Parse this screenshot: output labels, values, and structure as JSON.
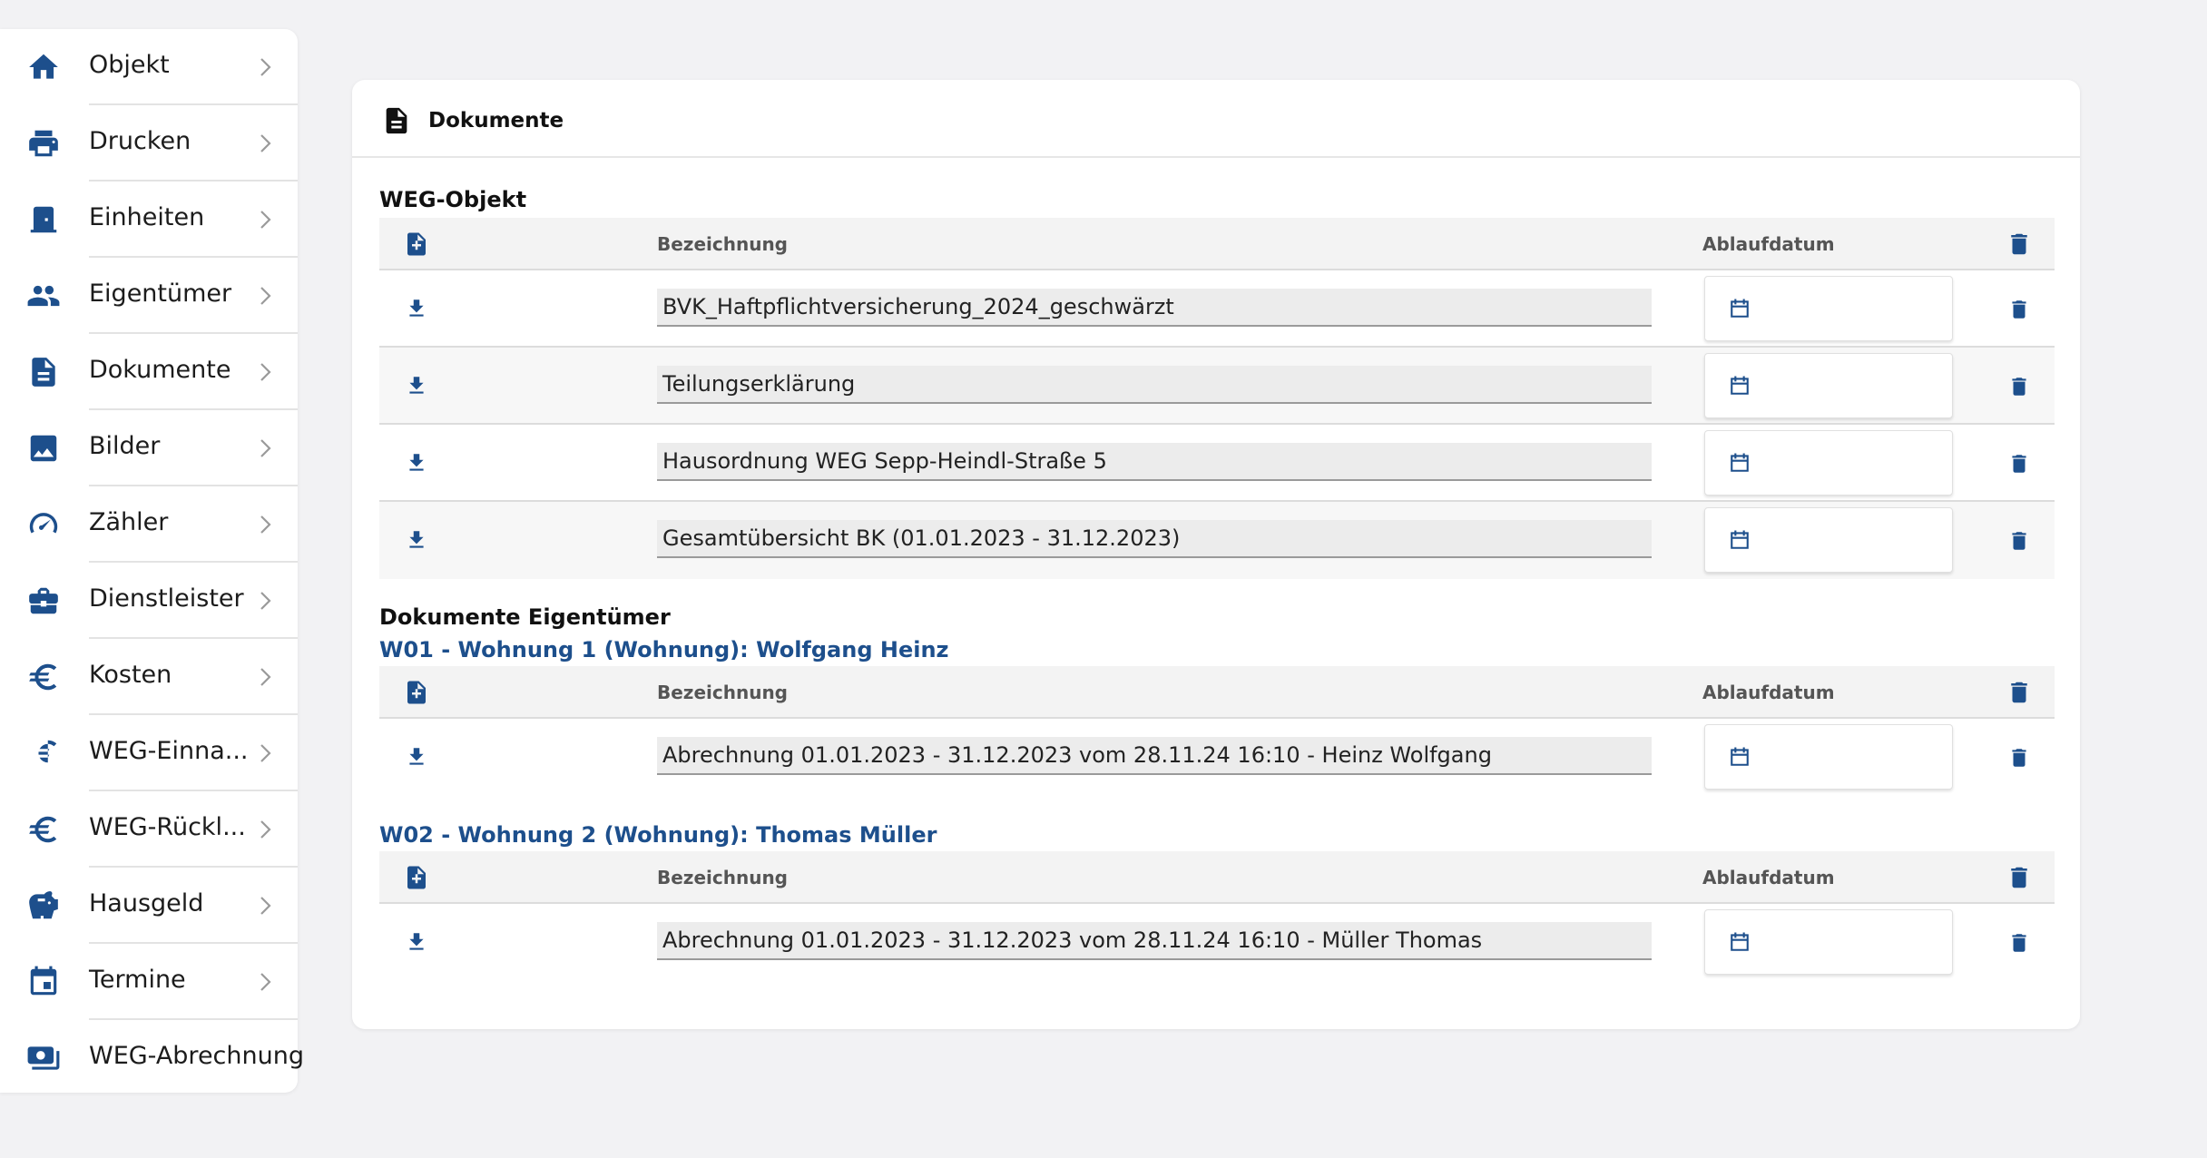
{
  "colors": {
    "accent": "#1d4f8c",
    "background": "#f2f2f4"
  },
  "sidebar": {
    "items": [
      {
        "label": "Objekt",
        "icon": "home-icon"
      },
      {
        "label": "Drucken",
        "icon": "printer-icon"
      },
      {
        "label": "Einheiten",
        "icon": "door-icon"
      },
      {
        "label": "Eigentümer",
        "icon": "people-icon"
      },
      {
        "label": "Dokumente",
        "icon": "document-icon"
      },
      {
        "label": "Bilder",
        "icon": "image-icon"
      },
      {
        "label": "Zähler",
        "icon": "gauge-icon"
      },
      {
        "label": "Dienstleister",
        "icon": "briefcase-icon"
      },
      {
        "label": "Kosten",
        "icon": "euro-icon"
      },
      {
        "label": "WEG-Einna...",
        "icon": "euro-icon"
      },
      {
        "label": "WEG-Rückl...",
        "icon": "euro-icon"
      },
      {
        "label": "Hausgeld",
        "icon": "piggy-bank-icon"
      },
      {
        "label": "Termine",
        "icon": "calendar-icon"
      },
      {
        "label": "WEG-Abrechnung",
        "icon": "money-icon"
      }
    ]
  },
  "card": {
    "title": "Dokumente",
    "weg_section": {
      "title": "WEG-Objekt",
      "headers": {
        "name": "Bezeichnung",
        "date": "Ablaufdatum"
      },
      "rows": [
        {
          "name": "BVK_Haftpflichtversicherung_2024_geschwärzt",
          "date": ""
        },
        {
          "name": "Teilungserklärung",
          "date": ""
        },
        {
          "name": "Hausordnung WEG Sepp-Heindl-Straße 5",
          "date": ""
        },
        {
          "name": "Gesamtübersicht BK (01.01.2023 - 31.12.2023)",
          "date": ""
        }
      ]
    },
    "owner_section": {
      "title": "Dokumente Eigentümer",
      "groups": [
        {
          "title": "W01 - Wohnung 1 (Wohnung): Wolfgang Heinz",
          "headers": {
            "name": "Bezeichnung",
            "date": "Ablaufdatum"
          },
          "rows": [
            {
              "name": "Abrechnung 01.01.2023 - 31.12.2023 vom 28.11.24 16:10 - Heinz Wolfgang",
              "date": ""
            }
          ]
        },
        {
          "title": "W02 - Wohnung 2 (Wohnung): Thomas Müller",
          "headers": {
            "name": "Bezeichnung",
            "date": "Ablaufdatum"
          },
          "rows": [
            {
              "name": "Abrechnung 01.01.2023 - 31.12.2023 vom 28.11.24 16:10 - Müller Thomas",
              "date": ""
            }
          ]
        }
      ]
    }
  }
}
